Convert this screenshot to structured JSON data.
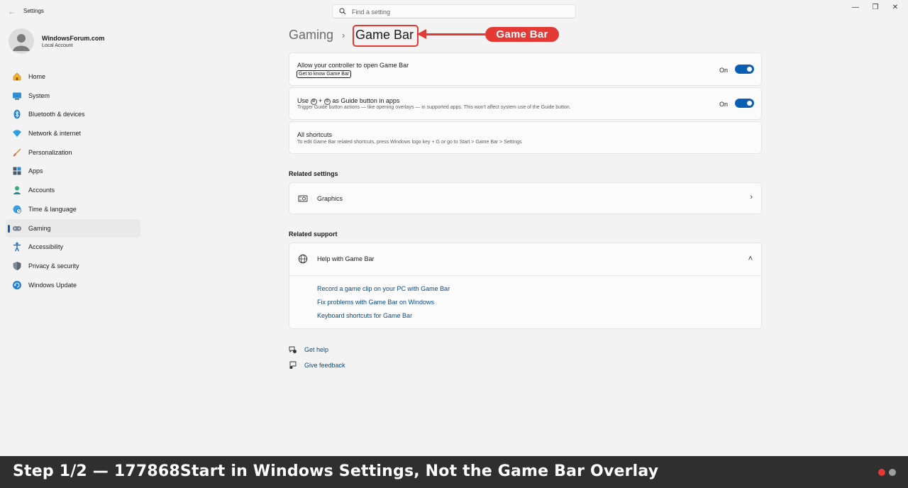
{
  "window": {
    "back_glyph": "←",
    "title": "Settings",
    "controls": [
      "—",
      "❐",
      "✕"
    ]
  },
  "search": {
    "placeholder": "Find a setting"
  },
  "account": {
    "name": "WindowsForum.com",
    "type": "Local Account"
  },
  "sidebar": {
    "items": [
      {
        "label": "Home",
        "icon": "home-icon"
      },
      {
        "label": "System",
        "icon": "system-icon"
      },
      {
        "label": "Bluetooth & devices",
        "icon": "bluetooth-icon"
      },
      {
        "label": "Network & internet",
        "icon": "network-icon"
      },
      {
        "label": "Personalization",
        "icon": "brush-icon"
      },
      {
        "label": "Apps",
        "icon": "apps-icon"
      },
      {
        "label": "Accounts",
        "icon": "accounts-icon"
      },
      {
        "label": "Time & language",
        "icon": "globe-clock-icon"
      },
      {
        "label": "Gaming",
        "icon": "gamepad-icon",
        "active": true
      },
      {
        "label": "Accessibility",
        "icon": "accessibility-icon"
      },
      {
        "label": "Privacy & security",
        "icon": "shield-icon"
      },
      {
        "label": "Windows Update",
        "icon": "update-icon"
      }
    ]
  },
  "breadcrumb": {
    "parent": "Gaming",
    "separator": "›",
    "current": "Game Bar"
  },
  "annotation": {
    "callout": "Game Bar",
    "color": "#e53935"
  },
  "settings": {
    "controller": {
      "title": "Allow your controller to open Game Bar",
      "link": "Get to know Game Bar",
      "toggle_label": "On",
      "toggle_on": true
    },
    "guide": {
      "title_pre": "Use",
      "glyph1": "⊛",
      "plus": "+",
      "glyph2": "⊜",
      "title_post": "as Guide button in apps",
      "description": "Trigger Guide button actions — like opening overlays — in supported apps. This won't affect system use of the Guide button.",
      "toggle_label": "On",
      "toggle_on": true
    },
    "shortcuts": {
      "title": "All shortcuts",
      "description": "To edit Game Bar related shortcuts, press Windows logo key + G or go to Start > Game Bar > Settings"
    }
  },
  "related_settings": {
    "heading": "Related settings",
    "graphics_label": "Graphics",
    "chevron": "›"
  },
  "related_support": {
    "heading": "Related support",
    "help_title": "Help with Game Bar",
    "chevron": "˄",
    "links": [
      "Record a game clip on your PC with Game Bar",
      "Fix problems with Game Bar on Windows",
      "Keyboard shortcuts for Game Bar"
    ]
  },
  "footer": {
    "get_help": "Get help",
    "give_feedback": "Give feedback"
  },
  "banner": {
    "text": "Step 1/2 — 177868Start in Windows Settings, Not the Game Bar Overlay",
    "dot_colors": [
      "#e53935",
      "#9e9e9e"
    ]
  },
  "colors": {
    "accent": "#0a5fb4",
    "link": "#0a4a8a",
    "background": "#f3f3f3",
    "card": "#fbfbfb"
  }
}
